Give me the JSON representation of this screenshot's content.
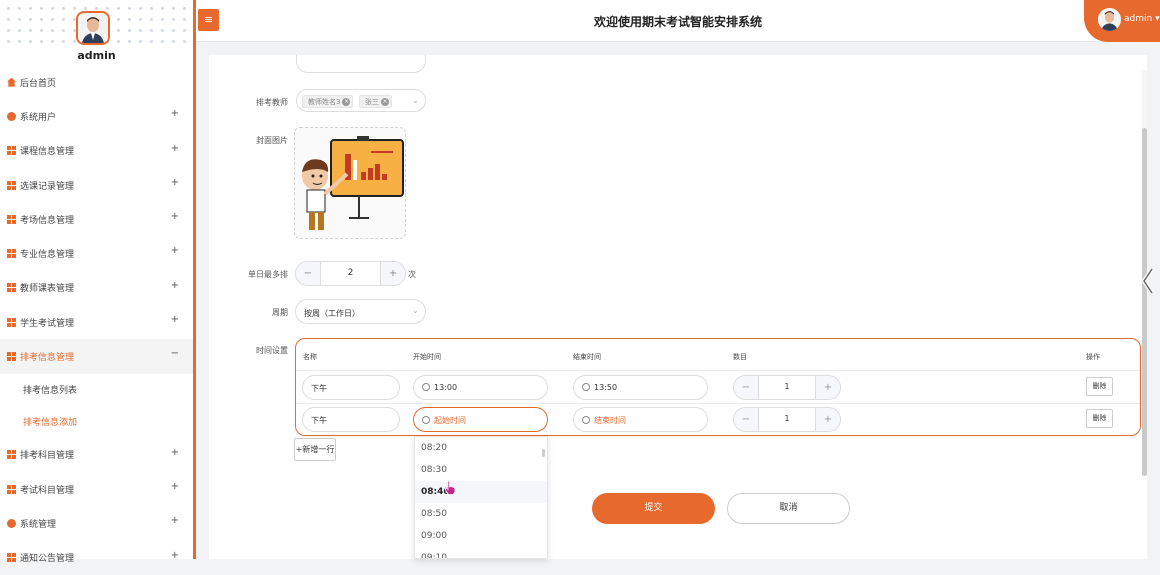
{
  "app": {
    "title": "欢迎使用期末考试智能安排系统",
    "user": "admin",
    "menu_toggle_icon": "≡"
  },
  "sidebar": {
    "username": "admin",
    "items": [
      {
        "label": "后台首页",
        "icon": "home-icon",
        "expandable": false
      },
      {
        "label": "系统用户",
        "icon": "user-icon",
        "expandable": true
      },
      {
        "label": "课程信息管理",
        "icon": "grid-icon",
        "expandable": true
      },
      {
        "label": "选课记录管理",
        "icon": "grid-icon",
        "expandable": true
      },
      {
        "label": "考场信息管理",
        "icon": "grid-icon",
        "expandable": true
      },
      {
        "label": "专业信息管理",
        "icon": "grid-icon",
        "expandable": true
      },
      {
        "label": "教师课表管理",
        "icon": "grid-icon",
        "expandable": true
      },
      {
        "label": "学生考试管理",
        "icon": "grid-icon",
        "expandable": true
      },
      {
        "label": "排考信息管理",
        "icon": "grid-icon",
        "expandable": true,
        "active": true
      },
      {
        "label": "排考信息列表",
        "sub": true
      },
      {
        "label": "排考信息添加",
        "sub": true,
        "current": true
      },
      {
        "label": "排考科目管理",
        "icon": "grid-icon",
        "expandable": true
      },
      {
        "label": "考试科目管理",
        "icon": "grid-icon",
        "expandable": true
      },
      {
        "label": "系统管理",
        "icon": "gear-icon",
        "expandable": true
      },
      {
        "label": "通知公告管理",
        "icon": "grid-icon",
        "expandable": true
      }
    ],
    "plus": "+",
    "minus": "−"
  },
  "form": {
    "teacher_label": "排考教师",
    "teacher_tags": [
      "教师姓名3",
      "张三"
    ],
    "cover_label": "封面图片",
    "daily_max_label": "单日最多排",
    "daily_max_value": "2",
    "daily_max_unit": "次",
    "period_label": "周期",
    "period_value": "按周（工作日）",
    "time_label": "时间设置",
    "columns": [
      "名称",
      "开始时间",
      "结束时间",
      "数目",
      "操作"
    ],
    "rows": [
      {
        "name": "下午",
        "start": "13:00",
        "end": "13:50",
        "count": "1",
        "action": "删除"
      },
      {
        "name": "下午",
        "start_placeholder": "起始时间",
        "end_placeholder": "结束时间",
        "count": "1",
        "action": "删除"
      }
    ],
    "add_row": "+新增一行",
    "submit": "提交",
    "cancel": "取消"
  },
  "time_dropdown": {
    "options": [
      "08:20",
      "08:30",
      "08:40",
      "08:50",
      "09:00",
      "09:10"
    ],
    "selected": "08:40"
  },
  "colors": {
    "accent": "#e8692d"
  }
}
